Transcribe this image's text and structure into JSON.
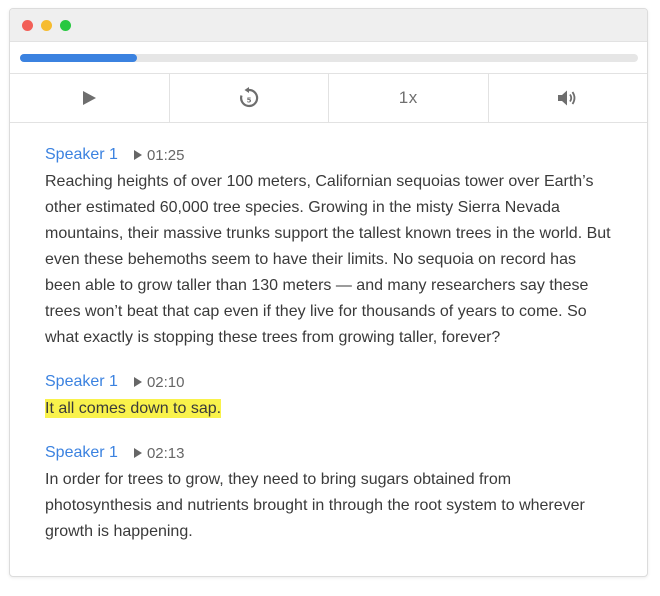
{
  "colors": {
    "close": "#f25f57",
    "minimize": "#f6bc2f",
    "maximize": "#27c840",
    "accent": "#3b82e0",
    "highlight": "#f9f24b"
  },
  "player": {
    "progress_fraction": 0.19,
    "controls": [
      {
        "name": "play-button",
        "icon": "play-icon"
      },
      {
        "name": "rewind-5-button",
        "icon": "rewind-5-icon"
      },
      {
        "name": "speed-button",
        "label": "1x"
      },
      {
        "name": "volume-button",
        "icon": "volume-icon"
      }
    ],
    "speed_label": "1x"
  },
  "transcript": {
    "segments": [
      {
        "speaker": "Speaker 1",
        "time": "01:25",
        "text": "Reaching heights of over 100 meters, Californian sequoias tower over Earth’s other estimated 60,000 tree species. Growing in the misty Sierra Nevada mountains, their massive trunks support the tallest known trees in the world. But even these behemoths seem to have their limits. No sequoia on record has been able to grow taller than 130 meters — and many researchers say these trees won’t beat that cap even if they live for thousands of years to come. So what exactly is stopping these trees from growing taller, forever?",
        "highlighted": false
      },
      {
        "speaker": "Speaker 1",
        "time": "02:10",
        "text": "It all comes down to sap.",
        "highlighted": true
      },
      {
        "speaker": "Speaker 1",
        "time": "02:13",
        "text": "In order for trees to grow, they need to bring sugars obtained from photosynthesis and nutrients brought in through the root system to wherever growth is happening.",
        "highlighted": false
      }
    ]
  }
}
